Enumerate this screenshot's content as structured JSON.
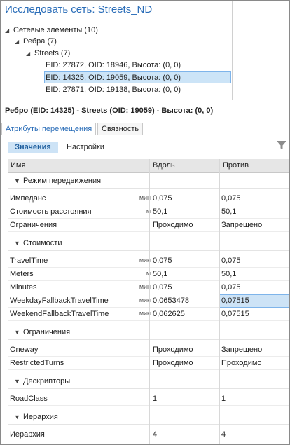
{
  "explore": {
    "title": "Исследовать сеть: Streets_ND",
    "tree": {
      "root": "Сетевые элементы (10)",
      "edges": "Ребра (7)",
      "streets": "Streets (7)",
      "items": [
        "EID: 27872, OID: 18946, Высота: (0, 0)",
        "EID: 14325, OID: 19059, Высота: (0, 0)",
        "EID: 27871, OID: 19138, Высота: (0, 0)"
      ],
      "selected_index": 1
    }
  },
  "detail": {
    "header": "Ребро (EID: 14325) - Streets (OID: 19059) - Высота: (0, 0)",
    "tabs": [
      "Атрибуты перемещения",
      "Связность"
    ],
    "active_tab": 0,
    "subtabs": [
      "Значения",
      "Настройки"
    ],
    "active_subtab": 0,
    "filter_icon": "filter-icon"
  },
  "grid": {
    "columns": [
      "Имя",
      "Вдоль",
      "Против"
    ],
    "categories": [
      {
        "label": "Режим передвижения",
        "rows": [
          {
            "name": "Импеданс",
            "unit": "мин",
            "along": "0,075",
            "against": "0,075"
          },
          {
            "name": "Стоимость расстояния",
            "unit": "м",
            "along": "50,1",
            "against": "50,1"
          },
          {
            "name": "Ограничения",
            "unit": "",
            "along": "Проходимо",
            "against": "Запрещено"
          }
        ]
      },
      {
        "label": "Стоимости",
        "rows": [
          {
            "name": "TravelTime",
            "unit": "мин",
            "along": "0,075",
            "against": "0,075"
          },
          {
            "name": "Meters",
            "unit": "м",
            "along": "50,1",
            "against": "50,1"
          },
          {
            "name": "Minutes",
            "unit": "мин",
            "along": "0,075",
            "against": "0,075"
          },
          {
            "name": "WeekdayFallbackTravelTime",
            "unit": "мин",
            "along": "0,0653478",
            "against": "0,07515",
            "selected": "against"
          },
          {
            "name": "WeekendFallbackTravelTime",
            "unit": "мин",
            "along": "0,062625",
            "against": "0,07515"
          }
        ]
      },
      {
        "label": "Ограничения",
        "rows": [
          {
            "name": "Oneway",
            "unit": "",
            "along": "Проходимо",
            "against": "Запрещено"
          },
          {
            "name": "RestrictedTurns",
            "unit": "",
            "along": "Проходимо",
            "against": "Проходимо"
          }
        ]
      },
      {
        "label": "Дескрипторы",
        "rows": [
          {
            "name": "RoadClass",
            "unit": "",
            "along": "1",
            "against": "1"
          }
        ]
      },
      {
        "label": "Иерархия",
        "rows": [
          {
            "name": "Иерархия",
            "unit": "",
            "along": "4",
            "against": "4"
          }
        ]
      }
    ]
  }
}
